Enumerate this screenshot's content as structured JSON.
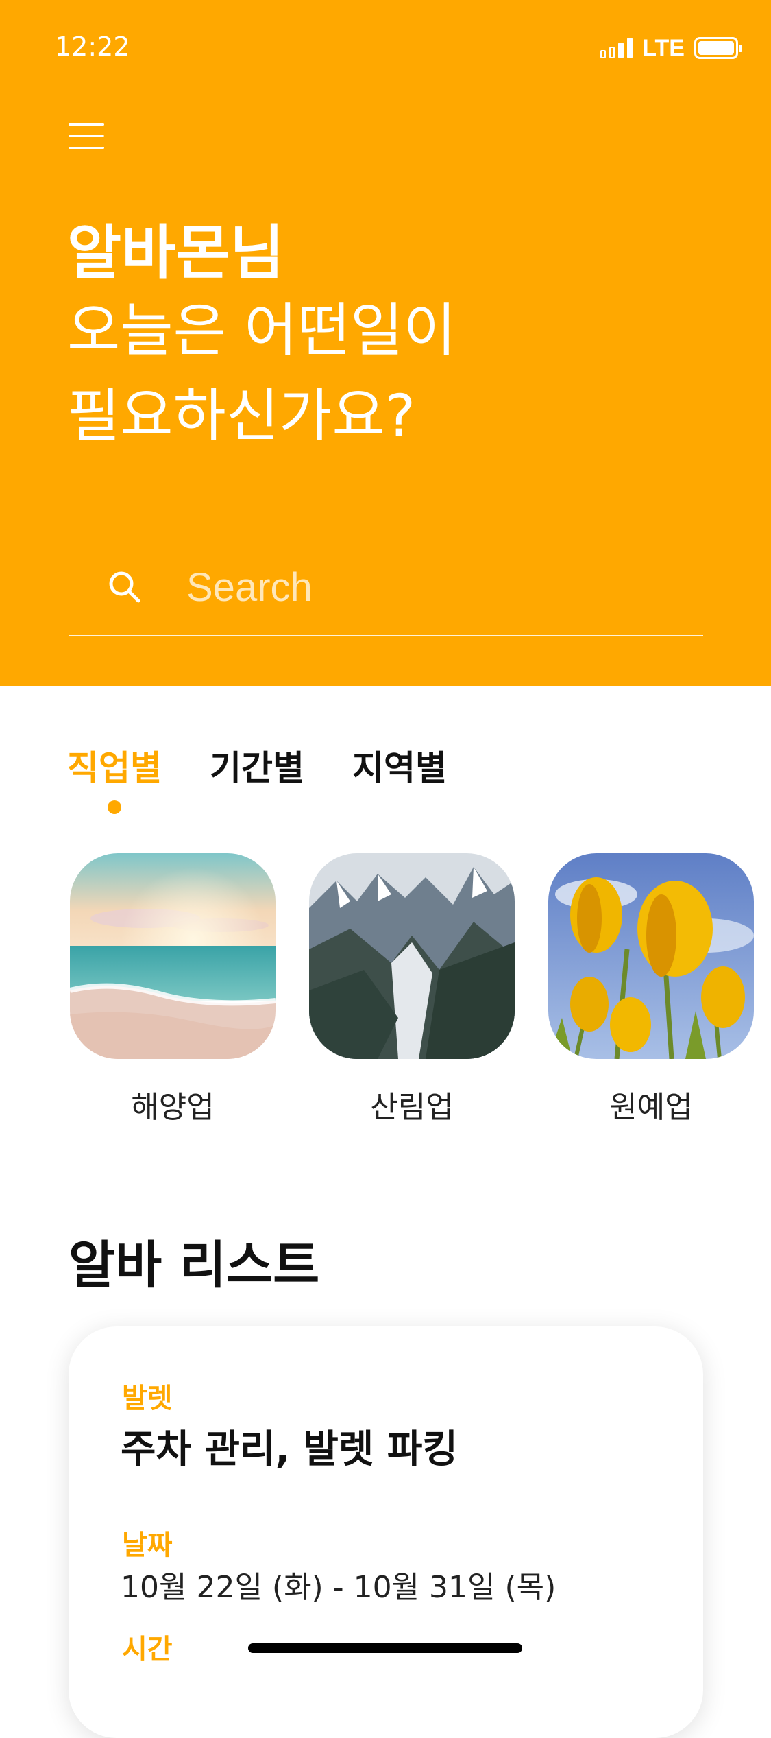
{
  "status_bar": {
    "time": "12:22",
    "network": "LTE"
  },
  "header": {
    "greeting_name": "알바몬님",
    "greeting_line1": "오늘은 어떤일이",
    "greeting_line2": "필요하신가요?"
  },
  "search": {
    "placeholder": "Search",
    "value": ""
  },
  "tabs": [
    {
      "label": "직업별",
      "active": true
    },
    {
      "label": "기간별",
      "active": false
    },
    {
      "label": "지역별",
      "active": false
    }
  ],
  "categories": [
    {
      "label": "해양업",
      "image": "beach-sunset-photo"
    },
    {
      "label": "산림업",
      "image": "mountain-glacier-photo"
    },
    {
      "label": "원예업",
      "image": "yellow-tulips-photo"
    }
  ],
  "job_list": {
    "title": "알바 리스트",
    "items": [
      {
        "category": "발렛",
        "title": "주차 관리, 발렛 파킹",
        "date_label": "날짜",
        "date": "10월 22일 (화) - 10월 31일 (목)",
        "time_label": "시간"
      }
    ]
  },
  "colors": {
    "accent": "#FFA800",
    "text": "#111111",
    "background": "#FFFFFF"
  }
}
